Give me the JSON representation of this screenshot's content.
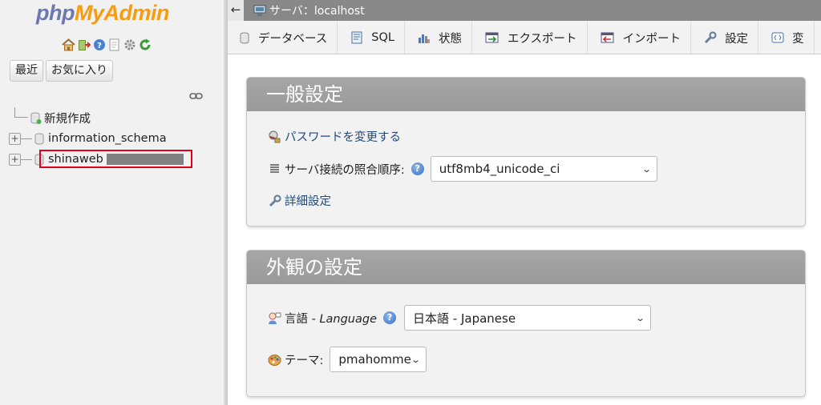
{
  "app": {
    "logo_php": "php",
    "logo_myadmin": "MyAdmin"
  },
  "nav": {
    "tabs": [
      "最近",
      "お気に入り"
    ],
    "tree": {
      "new_label": "新規作成",
      "db1": "information_schema",
      "db2": "shinaweb"
    },
    "icons": [
      "home-icon",
      "logout-icon",
      "help-icon",
      "docs-icon",
      "settings-icon",
      "reload-icon"
    ]
  },
  "topbar": {
    "back_glyph": "←",
    "server_label": "サーバ：localhost"
  },
  "menu": {
    "items": [
      "データベース",
      "SQL",
      "状態",
      "エクスポート",
      "インポート",
      "設定",
      "変"
    ]
  },
  "general": {
    "title": "一般設定",
    "change_password": "パスワードを変更する",
    "collation_label": "サーバ接続の照合順序:",
    "collation_value": "utf8mb4_unicode_ci",
    "more_settings": "詳細設定"
  },
  "appearance": {
    "title": "外観の設定",
    "language_label": "言語 - ",
    "language_label_en": "Language",
    "language_value": "日本語 - Japanese",
    "theme_label": "テーマ:",
    "theme_value": "pmahomme"
  },
  "colors": {
    "highlight_border": "#e0001a",
    "panel_header": "#9e9e9e",
    "logo_php": "#6c78af",
    "logo_myadmin": "#f89c0e"
  }
}
